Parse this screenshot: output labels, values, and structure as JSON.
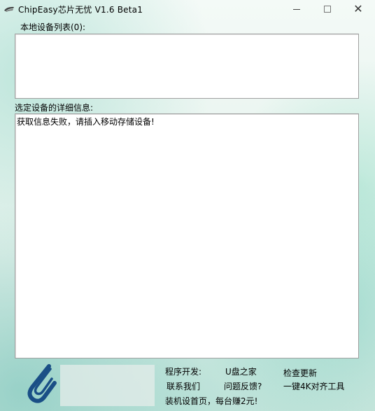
{
  "window": {
    "title": "ChipEasy芯片无忧 V1.6 Beta1",
    "controls": {
      "minimize_icon": "minimize-icon",
      "maximize_icon": "maximize-icon",
      "close_symbol": "✕"
    }
  },
  "device_list": {
    "label": "本地设备列表(0):",
    "items": []
  },
  "details": {
    "label": "选定设备的详细信息:",
    "text": "获取信息失败，请插入移动存储设备!"
  },
  "footer": {
    "developer_label": "程序开发:",
    "developer_link": "U盘之家",
    "check_update": "检查更新",
    "contact_us": "联系我们",
    "feedback": "问题反馈?",
    "align_tool": "一键4K对齐工具",
    "promo": "装机设首页，每台赚2元!"
  },
  "colors": {
    "logo_blue": "#1a4f86",
    "background_accent": "#cfe8df"
  }
}
